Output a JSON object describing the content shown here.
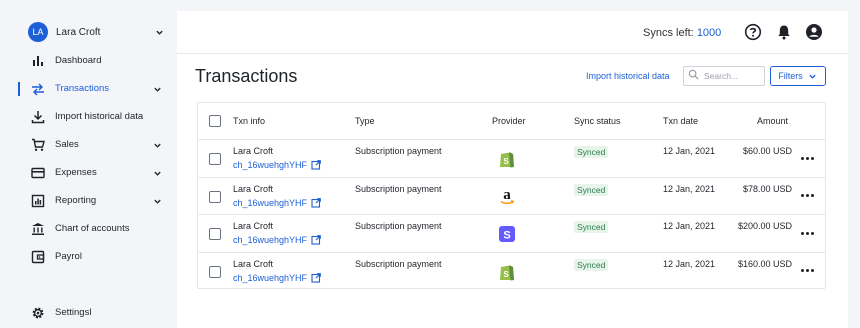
{
  "user": {
    "initials": "LA",
    "name": "Lara Croft"
  },
  "sidebar": {
    "items": [
      {
        "label": "Dashboard",
        "icon": "bar-chart-icon",
        "has_chevron": false
      },
      {
        "label": "Transactions",
        "icon": "swap-arrows-icon",
        "has_chevron": true,
        "active": true
      },
      {
        "label": "Import historical data",
        "icon": "download-icon",
        "has_chevron": false
      },
      {
        "label": "Sales",
        "icon": "cart-icon",
        "has_chevron": true
      },
      {
        "label": "Expenses",
        "icon": "credit-card-icon",
        "has_chevron": true
      },
      {
        "label": "Reporting",
        "icon": "report-icon",
        "has_chevron": true
      },
      {
        "label": "Chart of accounts",
        "icon": "bank-icon",
        "has_chevron": false
      },
      {
        "label": "Payrol",
        "icon": "wallet-icon",
        "has_chevron": false
      }
    ],
    "settings_label": "Settingsl"
  },
  "topbar": {
    "syncs_label": "Syncs left:",
    "syncs_value": "1000",
    "icons": [
      "help-icon",
      "bell-icon",
      "account-icon"
    ]
  },
  "page": {
    "title": "Transactions",
    "import_link": "Import historical data",
    "search_placeholder": "Search...",
    "filters_label": "Filters"
  },
  "table": {
    "headers": {
      "txn_info": "Txn info",
      "type": "Type",
      "provider": "Provider",
      "sync_status": "Sync status",
      "txn_date": "Txn date",
      "amount": "Amount"
    },
    "rows": [
      {
        "name": "Lara Croft",
        "txn_id": "ch_16wuehghYHF",
        "type": "Subscription payment",
        "provider": "shopify",
        "status": "Synced",
        "date": "12 Jan, 2021",
        "amount": "$60.00 USD"
      },
      {
        "name": "Lara Croft",
        "txn_id": "ch_16wuehghYHF",
        "type": "Subscription payment",
        "provider": "amazon",
        "status": "Synced",
        "date": "12 Jan, 2021",
        "amount": "$78.00 USD"
      },
      {
        "name": "Lara Croft",
        "txn_id": "ch_16wuehghYHF",
        "type": "Subscription payment",
        "provider": "stripe",
        "status": "Synced",
        "date": "12 Jan, 2021",
        "amount": "$200.00 USD"
      },
      {
        "name": "Lara Croft",
        "txn_id": "ch_16wuehghYHF",
        "type": "Subscription payment",
        "provider": "shopify",
        "status": "Synced",
        "date": "12 Jan, 2021",
        "amount": "$160.00 USD"
      }
    ]
  },
  "colors": {
    "accent": "#1d5fd6",
    "synced_text": "#2e7d4f",
    "synced_bg": "#e6f4ea",
    "shopify": "#95bf47",
    "stripe": "#635bff"
  }
}
